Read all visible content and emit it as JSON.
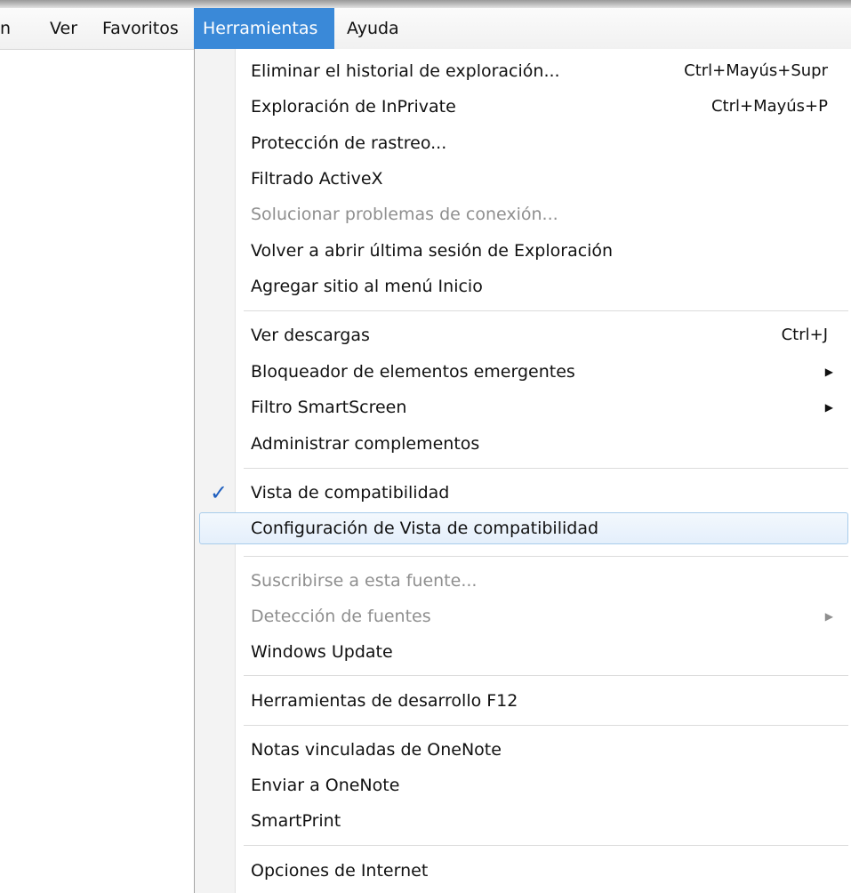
{
  "menubar": {
    "items": [
      {
        "label": "n"
      },
      {
        "label": "Ver"
      },
      {
        "label": "Favoritos"
      },
      {
        "label": "Herramientas"
      },
      {
        "label": "Ayuda"
      }
    ]
  },
  "menu": {
    "items": [
      {
        "label": "Eliminar el historial de exploración...",
        "shortcut": "Ctrl+Mayús+Supr"
      },
      {
        "label": "Exploración de InPrivate",
        "shortcut": "Ctrl+Mayús+P"
      },
      {
        "label": "Protección de rastreo..."
      },
      {
        "label": "Filtrado ActiveX"
      },
      {
        "label": "Solucionar problemas de conexión...",
        "disabled": true
      },
      {
        "label": "Volver a abrir última sesión de Exploración"
      },
      {
        "label": "Agregar sitio al menú Inicio"
      },
      {
        "label": "Ver descargas",
        "shortcut": "Ctrl+J"
      },
      {
        "label": "Bloqueador de elementos emergentes",
        "arrow": "▶"
      },
      {
        "label": "Filtro SmartScreen",
        "arrow": "▶"
      },
      {
        "label": "Administrar complementos"
      },
      {
        "label": "Vista de compatibilidad",
        "check": "✓"
      },
      {
        "label": "Configuración de Vista de compatibilidad",
        "highlighted": true
      },
      {
        "label": "Suscribirse a esta fuente...",
        "disabled": true
      },
      {
        "label": "Detección de fuentes",
        "arrow": "▶",
        "disabled": true
      },
      {
        "label": "Windows Update"
      },
      {
        "label": "Herramientas de desarrollo F12"
      },
      {
        "label": "Notas vinculadas de OneNote"
      },
      {
        "label": "Enviar a OneNote"
      },
      {
        "label": "SmartPrint"
      },
      {
        "label": "Opciones de Internet"
      }
    ]
  },
  "colors": {
    "menubar_active_bg": "#3a89d8",
    "check_color": "#1f5fbf",
    "disabled_text": "#8f8f8f",
    "highlight_border": "#a8cceb"
  }
}
